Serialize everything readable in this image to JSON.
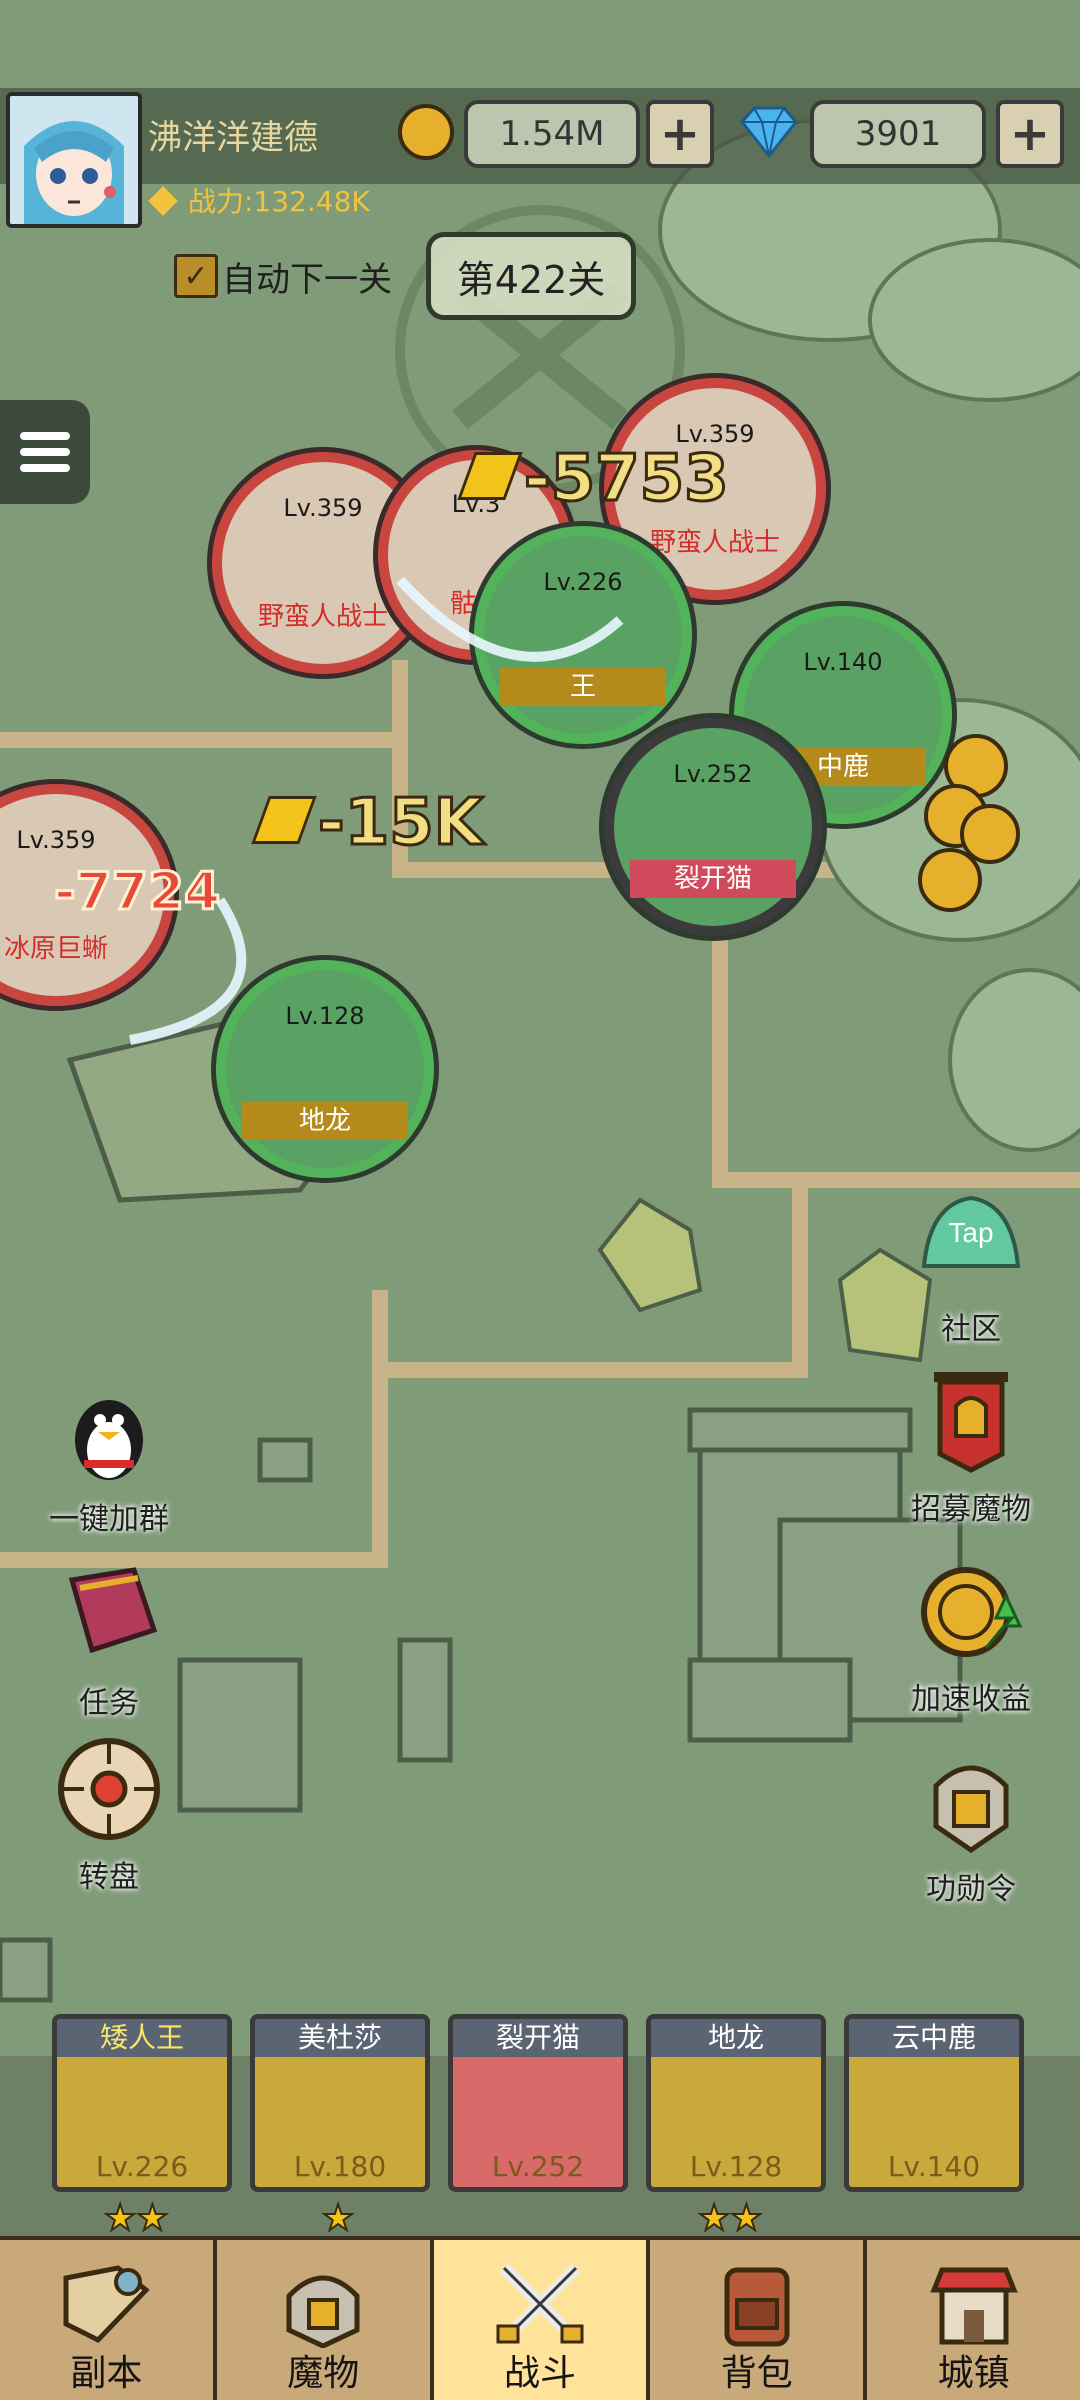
{
  "player": {
    "name": "沸洋洋建德",
    "power": "战力:132.48K"
  },
  "currency": {
    "gold": "1.54M",
    "gems": "3901"
  },
  "level": {
    "auto_next_label": "自动下一关",
    "auto_next_checked": true,
    "stage": "第422关"
  },
  "enemies": [
    {
      "level": "Lv.359",
      "name": "野蛮人战士"
    },
    {
      "level": "Lv.3",
      "name": "骷髅"
    },
    {
      "level": "Lv.359",
      "name": "野蛮人战士"
    },
    {
      "level": "Lv.359",
      "name": "冰原巨蜥"
    }
  ],
  "allies": [
    {
      "level": "Lv.226",
      "name": "王"
    },
    {
      "level": "Lv.140",
      "name": "中鹿"
    },
    {
      "level": "Lv.252",
      "name": "裂开猫"
    },
    {
      "level": "Lv.128",
      "name": "地龙"
    }
  ],
  "damage": {
    "d1": "-5753",
    "d2": "-15K",
    "d3": "-7724"
  },
  "features": {
    "community": "社区",
    "community_tap": "Tap",
    "join_group": "一键加群",
    "recruit": "招募魔物",
    "tasks": "任务",
    "speed_up": "加速收益",
    "wheel": "转盘",
    "merit": "功勋令"
  },
  "heroes": [
    {
      "name": "矮人王",
      "level": "Lv.226",
      "stars": "★★",
      "name_color": "#f5e56a"
    },
    {
      "name": "美杜莎",
      "level": "Lv.180",
      "stars": "★",
      "name_color": "#ffffff"
    },
    {
      "name": "裂开猫",
      "level": "Lv.252",
      "stars": "",
      "name_color": "#ffffff"
    },
    {
      "name": "地龙",
      "level": "Lv.128",
      "stars": "★★",
      "name_color": "#ffffff"
    },
    {
      "name": "云中鹿",
      "level": "Lv.140",
      "stars": "",
      "name_color": "#ffffff"
    }
  ],
  "nav": [
    {
      "label": "副本",
      "active": false
    },
    {
      "label": "魔物",
      "active": false
    },
    {
      "label": "战斗",
      "active": true
    },
    {
      "label": "背包",
      "active": false
    },
    {
      "label": "城镇",
      "active": false
    }
  ]
}
